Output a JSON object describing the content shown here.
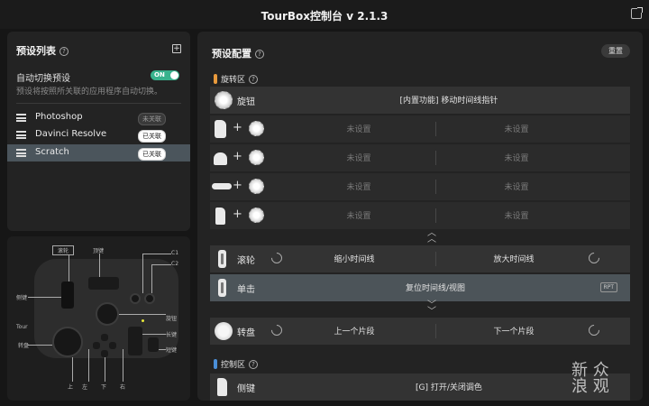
{
  "window": {
    "title": "TourBox控制台 v 2.1.3"
  },
  "preset_list": {
    "title": "预设列表",
    "auto_switch_label": "自动切换预设",
    "toggle_text": "ON",
    "auto_switch_desc": "预设将按照所关联的应用程序自动切换。",
    "items": [
      {
        "name": "Photoshop",
        "badge": "未关联",
        "active": false
      },
      {
        "name": "Davinci Resolve",
        "badge": "已关联",
        "active": false
      },
      {
        "name": "Scratch",
        "badge": "已关联",
        "active": true
      }
    ]
  },
  "device_map": {
    "labels": {
      "scroll": "滚轮",
      "knob": "顶键",
      "c1": "C1",
      "c2": "C2",
      "side": "侧键",
      "tour": "Tour",
      "rotary": "旋钮",
      "dial": "转盘",
      "long": "长键",
      "short": "短键",
      "up": "上",
      "left": "左",
      "down": "下",
      "right": "右"
    }
  },
  "config": {
    "title": "预设配置",
    "reset_label": "重置",
    "sections": {
      "rotary": "旋转区",
      "control": "控制区"
    },
    "knob_row": {
      "label": "旋钮",
      "value": "[内置功能] 移动时间线指针"
    },
    "unset": "未设置",
    "scroll_row": {
      "label": "滚轮",
      "left": "缩小时间线",
      "right": "放大时间线"
    },
    "click_row": {
      "label": "单击",
      "value": "复位时间线/视图",
      "rpt": "RPT"
    },
    "dial_row": {
      "label": "转盘",
      "left": "上一个片段",
      "right": "下一个片段"
    },
    "side_row": {
      "label": "侧键",
      "value": "[G] 打开/关闭调色"
    }
  },
  "watermark": {
    "line1": "新 众",
    "line2": "浪 观"
  },
  "colors": {
    "accent_green": "#38b28d",
    "rotary_section": "#e89a3c",
    "control_section": "#4a8fd9"
  }
}
